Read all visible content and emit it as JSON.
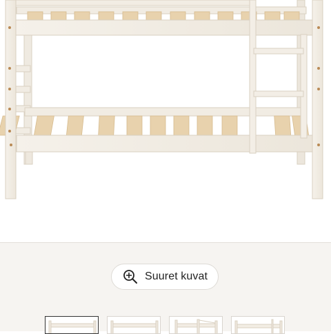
{
  "gallery": {
    "zoom_button_label": "Suuret kuvat",
    "thumbnail_count": 4,
    "active_thumbnail_index": 0
  },
  "colors": {
    "page_background": "#ffffff",
    "gallery_background": "#f6f4f1",
    "bed_frame": "#f2ede4",
    "bed_outline": "#d9d0c1",
    "slats": "#e8d2ad",
    "dowels": "#b98a55"
  },
  "icons": {
    "zoom": "magnifier-plus-icon"
  }
}
